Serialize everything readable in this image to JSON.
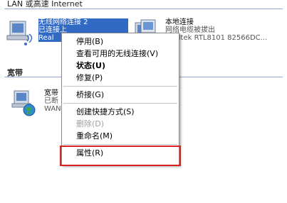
{
  "sections": {
    "lan_title": "LAN 或高速 Internet",
    "broadband_title": "宽带"
  },
  "connections": {
    "wireless": {
      "name": "无线网络连接 2",
      "status": "已连接上",
      "device": "Real",
      "icon": "wireless-network-icon"
    },
    "local": {
      "name": "本地连接",
      "status": "网络电缆被拔出",
      "device": "Realtek RTL8101 82566DC...",
      "icon": "local-network-disconnected-icon"
    },
    "broadband": {
      "name": "宽带",
      "status": "已断",
      "device": "WAN",
      "icon": "broadband-globe-icon"
    }
  },
  "context_menu": {
    "disable": "停用(B)",
    "view_wireless": "查看可用的无线连接(V)",
    "status": "状态(U)",
    "repair": "修复(P)",
    "bridge": "桥接(G)",
    "create_shortcut": "创建快捷方式(S)",
    "delete": "删除(D)",
    "rename": "重命名(M)",
    "properties": "属性(R)"
  },
  "colors": {
    "selection": "#316ac5",
    "highlight_frame": "#d9221f"
  }
}
